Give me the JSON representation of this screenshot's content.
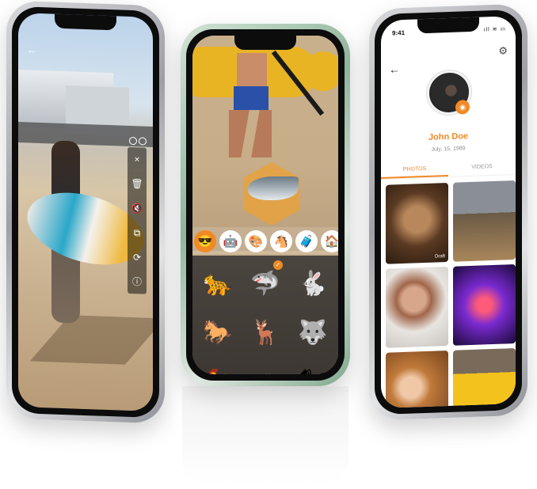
{
  "left_phone": {
    "tools": [
      "×",
      "🗑",
      "🔇",
      "⧉",
      "⟳",
      "ⓘ"
    ],
    "icons": {
      "back": "back-arrow-icon"
    }
  },
  "middle_phone": {
    "stickers": [
      "😎",
      "🤖",
      "🎨",
      "🐴",
      "🧳",
      "🏠",
      "🧩"
    ],
    "animals": [
      "🐆",
      "🦈",
      "🐇",
      "🐎",
      "🦌",
      "🐺",
      "🐓",
      "🦔",
      "🐿"
    ]
  },
  "right_phone": {
    "status_time": "9:41",
    "status_icons": "ıll ≋ ▭",
    "profile": {
      "name": "John Doe",
      "dob": "July, 15, 1989"
    },
    "tabs": [
      "PHOTOS",
      "VIDEOS"
    ],
    "photos": [
      {
        "label": "Draft"
      },
      {
        "label": ""
      },
      {
        "label": ""
      },
      {
        "label": ""
      },
      {
        "label": ""
      },
      {
        "label": ""
      }
    ]
  }
}
